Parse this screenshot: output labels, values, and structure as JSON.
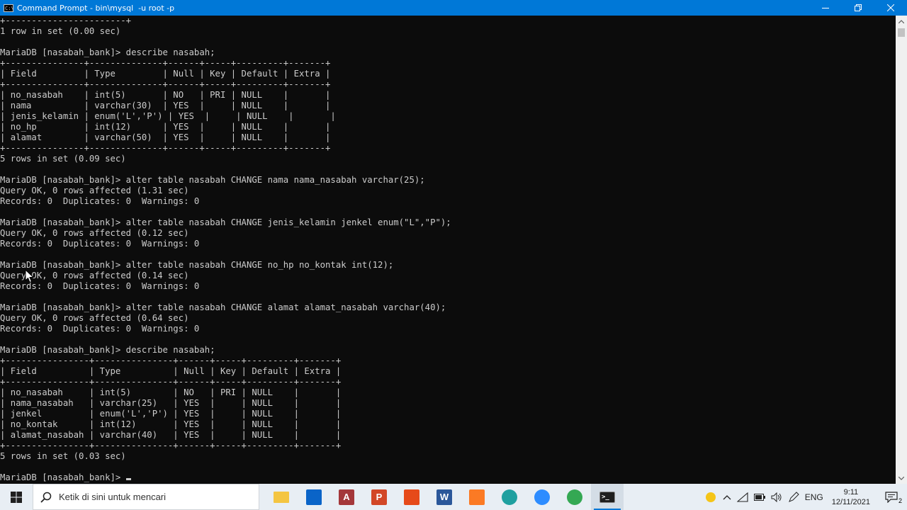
{
  "window": {
    "title": "Command Prompt - bin\\mysql  -u root -p",
    "icon": "C:\\",
    "controls": {
      "minimize_icon": "minimize-icon",
      "maximize_icon": "maximize-icon",
      "close_icon": "close-icon"
    }
  },
  "console": {
    "lines": [
      "+-----------------------+",
      "1 row in set (0.00 sec)",
      "",
      "MariaDB [nasabah_bank]> describe nasabah;",
      "+---------------+--------------+------+-----+---------+-------+",
      "| Field         | Type         | Null | Key | Default | Extra |",
      "+---------------+--------------+------+-----+---------+-------+",
      "| no_nasabah    | int(5)       | NO   | PRI | NULL    |       |",
      "| nama          | varchar(30)  | YES  |     | NULL    |       |",
      "| jenis_kelamin | enum('L','P') | YES  |     | NULL    |       |",
      "| no_hp         | int(12)      | YES  |     | NULL    |       |",
      "| alamat        | varchar(50)  | YES  |     | NULL    |       |",
      "+---------------+--------------+------+-----+---------+-------+",
      "5 rows in set (0.09 sec)",
      "",
      "MariaDB [nasabah_bank]> alter table nasabah CHANGE nama nama_nasabah varchar(25);",
      "Query OK, 0 rows affected (1.31 sec)",
      "Records: 0  Duplicates: 0  Warnings: 0",
      "",
      "MariaDB [nasabah_bank]> alter table nasabah CHANGE jenis_kelamin jenkel enum(\"L\",\"P\");",
      "Query OK, 0 rows affected (0.12 sec)",
      "Records: 0  Duplicates: 0  Warnings: 0",
      "",
      "MariaDB [nasabah_bank]> alter table nasabah CHANGE no_hp no_kontak int(12);",
      "Query OK, 0 rows affected (0.14 sec)",
      "Records: 0  Duplicates: 0  Warnings: 0",
      "",
      "MariaDB [nasabah_bank]> alter table nasabah CHANGE alamat alamat_nasabah varchar(40);",
      "Query OK, 0 rows affected (0.64 sec)",
      "Records: 0  Duplicates: 0  Warnings: 0",
      "",
      "MariaDB [nasabah_bank]> describe nasabah;",
      "+----------------+---------------+------+-----+---------+-------+",
      "| Field          | Type          | Null | Key | Default | Extra |",
      "+----------------+---------------+------+-----+---------+-------+",
      "| no_nasabah     | int(5)        | NO   | PRI | NULL    |       |",
      "| nama_nasabah   | varchar(25)   | YES  |     | NULL    |       |",
      "| jenkel         | enum('L','P') | YES  |     | NULL    |       |",
      "| no_kontak      | int(12)       | YES  |     | NULL    |       |",
      "| alamat_nasabah | varchar(40)   | YES  |     | NULL    |       |",
      "+----------------+---------------+------+-----+---------+-------+",
      "5 rows in set (0.03 sec)",
      "",
      "MariaDB [nasabah_bank]> "
    ]
  },
  "taskbar": {
    "search_placeholder": "Ketik di sini untuk mencari",
    "apps": [
      {
        "name": "file-explorer",
        "icon": "folder-icon",
        "color": "#f4c542"
      },
      {
        "name": "mail",
        "icon": "mail-icon",
        "color": "#0a64c8"
      },
      {
        "name": "access",
        "icon": "access-icon",
        "label": "A",
        "color": "#a4373a"
      },
      {
        "name": "powerpoint",
        "icon": "powerpoint-icon",
        "label": "P",
        "color": "#d24726"
      },
      {
        "name": "office",
        "icon": "office-icon",
        "color": "#e64a19"
      },
      {
        "name": "word",
        "icon": "word-icon",
        "label": "W",
        "color": "#2b579a"
      },
      {
        "name": "xampp",
        "icon": "xampp-icon",
        "color": "#fb7a24"
      },
      {
        "name": "edge",
        "icon": "edge-icon",
        "color": "#1fa0a0"
      },
      {
        "name": "zoom",
        "icon": "zoom-icon",
        "color": "#2d8cff"
      },
      {
        "name": "chrome",
        "icon": "chrome-icon",
        "color": "#34a853"
      },
      {
        "name": "command-prompt",
        "icon": "terminal-icon",
        "color": "#1e1e1e",
        "active": true
      }
    ],
    "tray": {
      "language": "ENG",
      "time": "9:11",
      "date": "12/11/2021",
      "notification_count": "2"
    }
  }
}
